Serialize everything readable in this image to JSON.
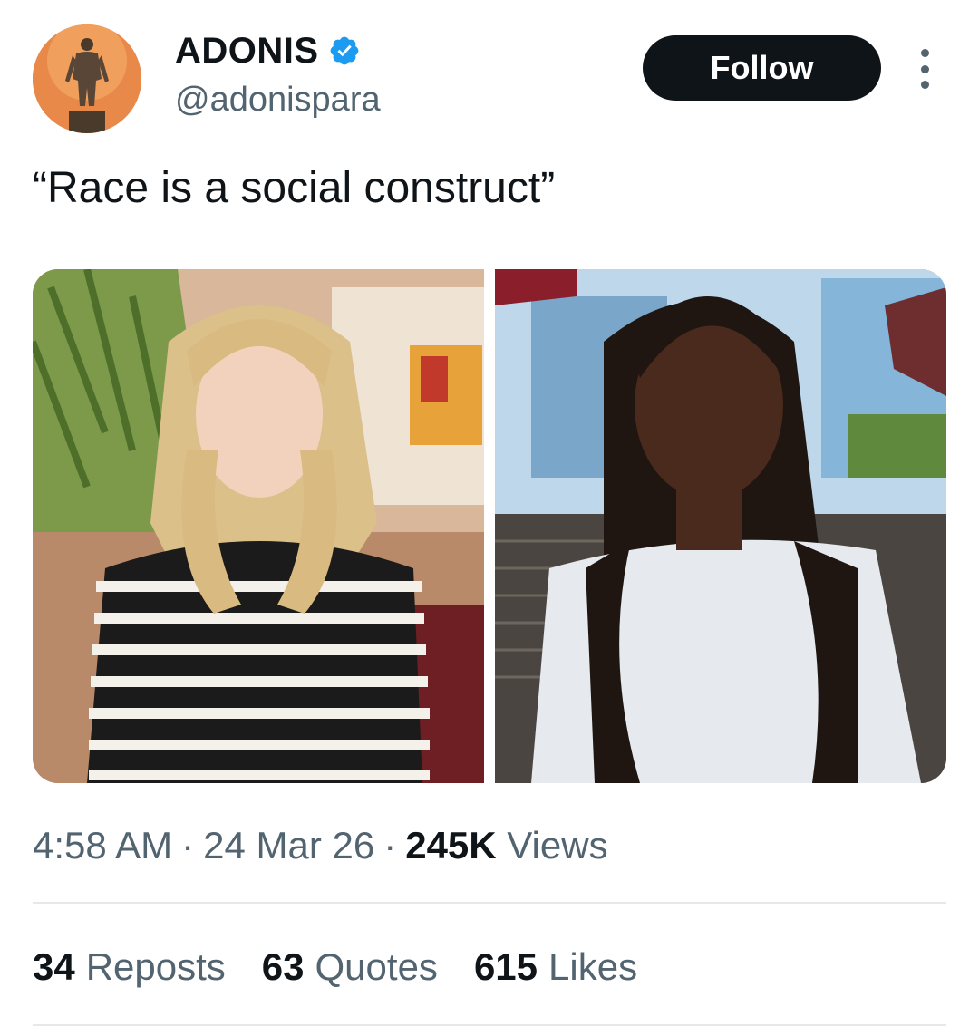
{
  "author": {
    "display_name": "ADONIS",
    "handle": "@adonispara",
    "verified": true,
    "avatar_icon": "avatar-statue"
  },
  "actions": {
    "follow_label": "Follow",
    "more_icon": "more-vertical-icon"
  },
  "tweet": {
    "text": "“Race is a social construct”"
  },
  "media": {
    "photos": [
      {
        "icon": "photo-blonde-woman-striped-sweater"
      },
      {
        "icon": "photo-dark-haired-woman-gray-tshirt"
      }
    ]
  },
  "meta": {
    "time": "4:58 AM",
    "separator": "·",
    "date": "24 Mar 26",
    "views_count": "245K",
    "views_label": "Views"
  },
  "stats": {
    "reposts_count": "34",
    "reposts_label": "Reposts",
    "quotes_count": "63",
    "quotes_label": "Quotes",
    "likes_count": "615",
    "likes_label": "Likes"
  },
  "colors": {
    "text_primary": "#0f1419",
    "text_secondary": "#536471",
    "verified_blue": "#1d9bf0",
    "divider": "#e6e9eb"
  }
}
